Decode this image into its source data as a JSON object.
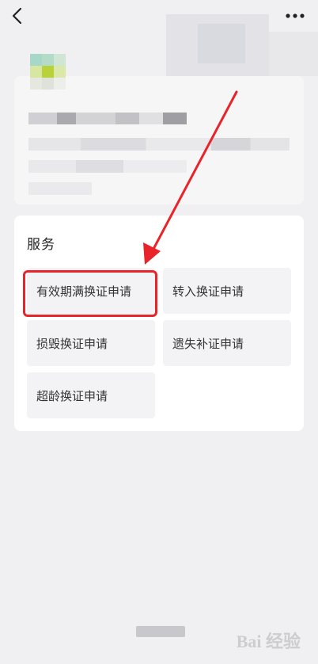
{
  "header": {
    "back_icon": "chevron-left-icon",
    "more_icon": "more-horizontal-icon"
  },
  "services": {
    "title": "服务",
    "items": [
      {
        "label": "有效期满换证申请",
        "highlighted": true
      },
      {
        "label": "转入换证申请",
        "highlighted": false
      },
      {
        "label": "损毁换证申请",
        "highlighted": false
      },
      {
        "label": "遗失补证申请",
        "highlighted": false
      },
      {
        "label": "超龄换证申请",
        "highlighted": false
      }
    ]
  },
  "annotation": {
    "arrow_color": "#e8232a",
    "box_color": "#e8232a"
  },
  "watermark": {
    "text": "Bai 经验"
  },
  "colors": {
    "page_bg": "#f0f0f2",
    "card_bg": "#ffffff",
    "tile_bg": "#f3f3f5",
    "accent_red": "#e8232a"
  }
}
